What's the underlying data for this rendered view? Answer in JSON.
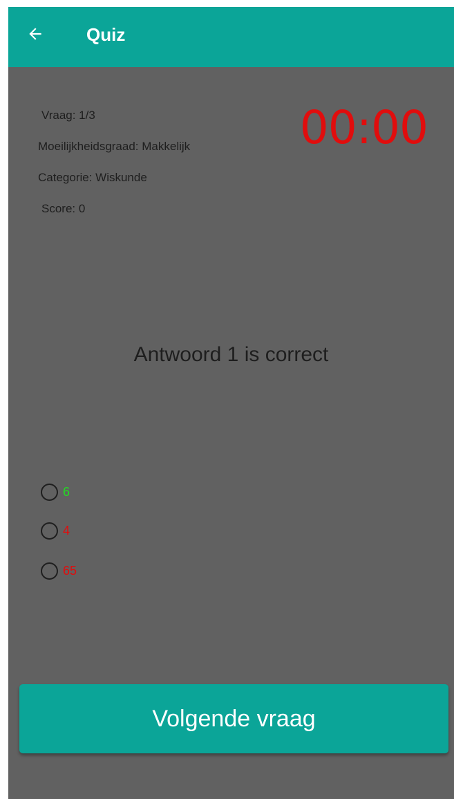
{
  "app_bar": {
    "back_icon": "arrow-left-icon",
    "title": "Quiz",
    "color": "#0ba598"
  },
  "info": {
    "question": "Vraag: 1/3",
    "difficulty": "Moeilijkheidsgraad: Makkelijk",
    "category": "Categorie: Wiskunde",
    "score": "Score: 0"
  },
  "timer": {
    "value": "00:00",
    "color": "#e10d0d"
  },
  "feedback": "Antwoord 1 is correct",
  "options": [
    {
      "label": "6",
      "color": "#22dd22",
      "selected": false
    },
    {
      "label": "4",
      "color": "#e10d0d",
      "selected": false
    },
    {
      "label": "65",
      "color": "#e10d0d",
      "selected": false
    }
  ],
  "next_button": {
    "label": "Volgende vraag"
  }
}
